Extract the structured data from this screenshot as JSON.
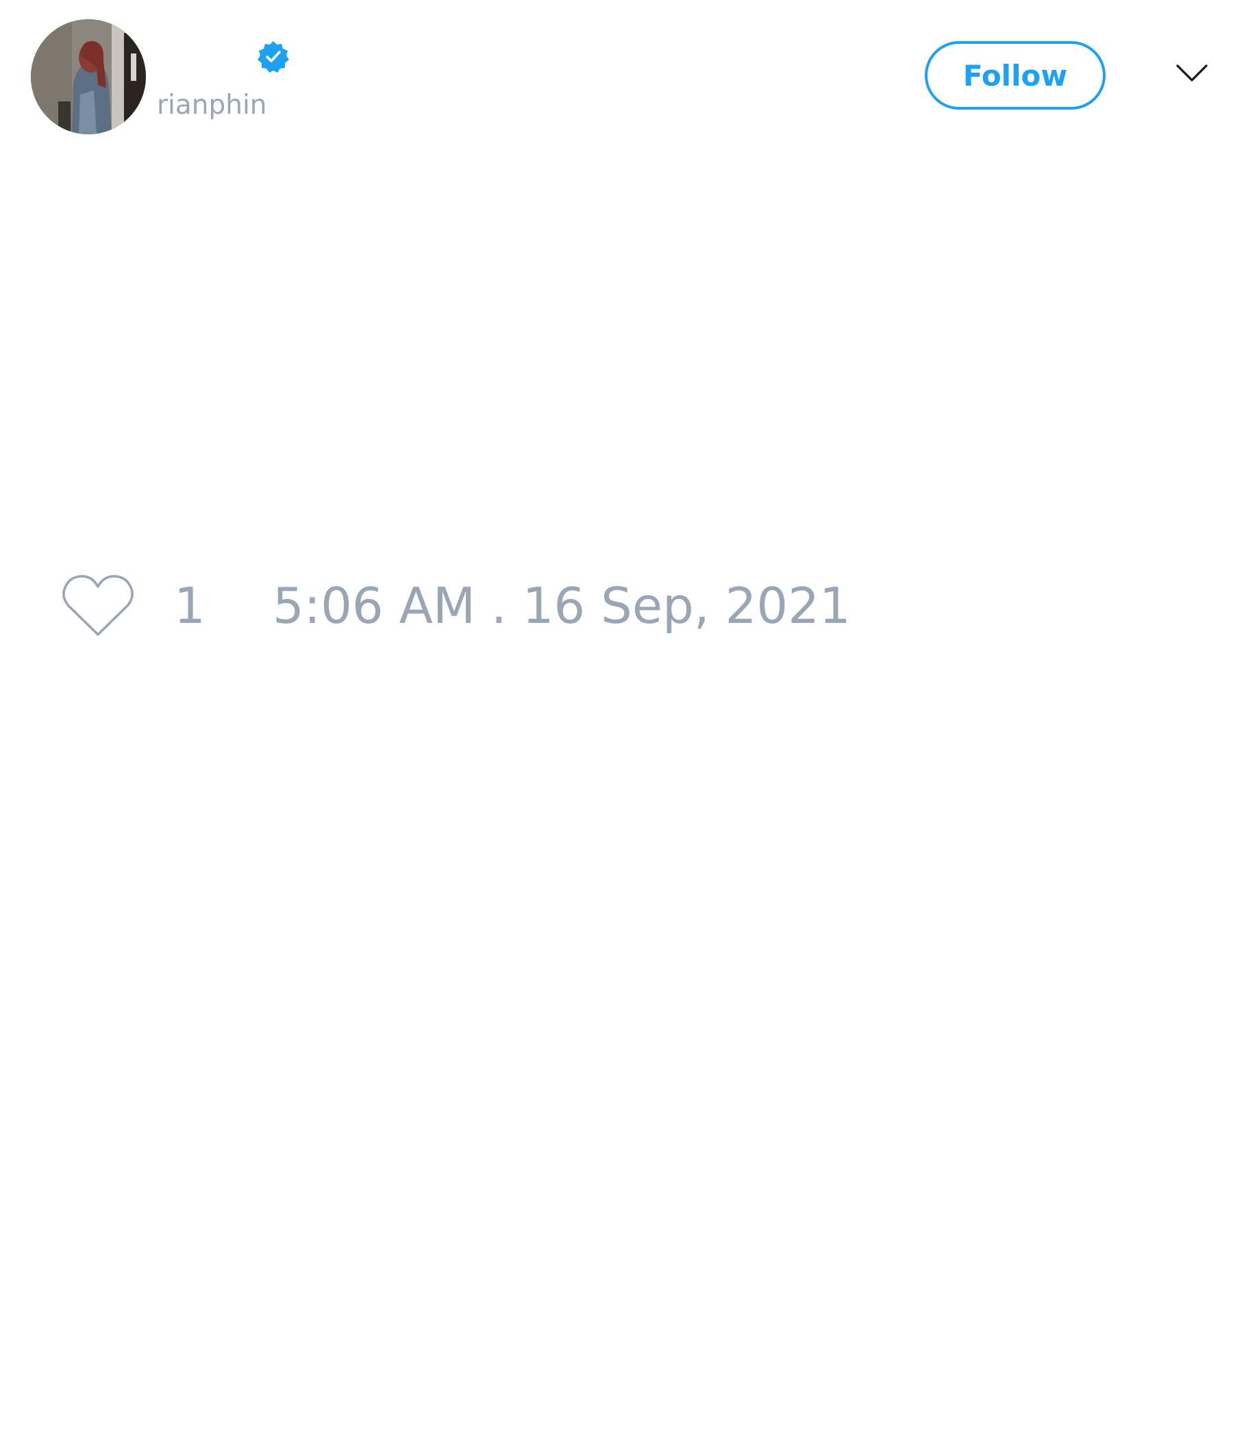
{
  "tweet": {
    "author": {
      "display_name": "",
      "handle": "rianphin",
      "verified": true
    },
    "follow_button_label": "Follow",
    "body_text": "",
    "like_count": "1",
    "timestamp": "5:06 AM . 16 Sep, 2021"
  },
  "icons": {
    "verified": "verified-badge-icon",
    "menu": "chevron-down-icon",
    "like": "heart-icon"
  },
  "colors": {
    "accent": "#1da1f2",
    "muted_text": "#9aa5b6",
    "background": "#ffffff"
  }
}
